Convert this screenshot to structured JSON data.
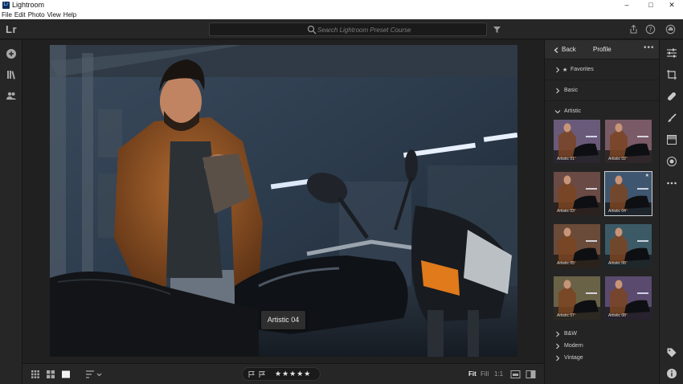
{
  "window": {
    "app_icon": "Lr",
    "title": "Lightroom",
    "controls": [
      "–",
      "□",
      "✕"
    ]
  },
  "menu": [
    "File",
    "Edit",
    "Photo",
    "View",
    "Help"
  ],
  "topbar": {
    "logo": "Lr",
    "search_placeholder": "Search Lightroom Preset Course"
  },
  "photo": {
    "tooltip": "Artistic 04"
  },
  "bottombar": {
    "stars": "★★★★★",
    "zoom": [
      "Fit",
      "Fill",
      "1:1"
    ]
  },
  "panel": {
    "back_label": "Back",
    "title": "Profile",
    "more": "•••",
    "favorites": "Favorites",
    "basic": "Basic",
    "artistic": "Artistic",
    "thumbnails": [
      {
        "label": "Artistic 01",
        "tone": "#6a5a7a"
      },
      {
        "label": "Artistic 02",
        "tone": "#7a5a66"
      },
      {
        "label": "Artistic 03",
        "tone": "#6a4a44"
      },
      {
        "label": "Artistic 04",
        "tone": "#3f5670"
      },
      {
        "label": "Artistic 05",
        "tone": "#6a4a38"
      },
      {
        "label": "Artistic 06",
        "tone": "#3c5a66"
      },
      {
        "label": "Artistic 07",
        "tone": "#6a6246"
      },
      {
        "label": "Artistic 08",
        "tone": "#5a4a6e"
      }
    ],
    "bw": "B&W",
    "modern": "Modern",
    "vintage": "Vintage"
  },
  "colors": {
    "background": "#1d1d1d",
    "panel": "#242424",
    "accent": "#e8e8e8"
  }
}
